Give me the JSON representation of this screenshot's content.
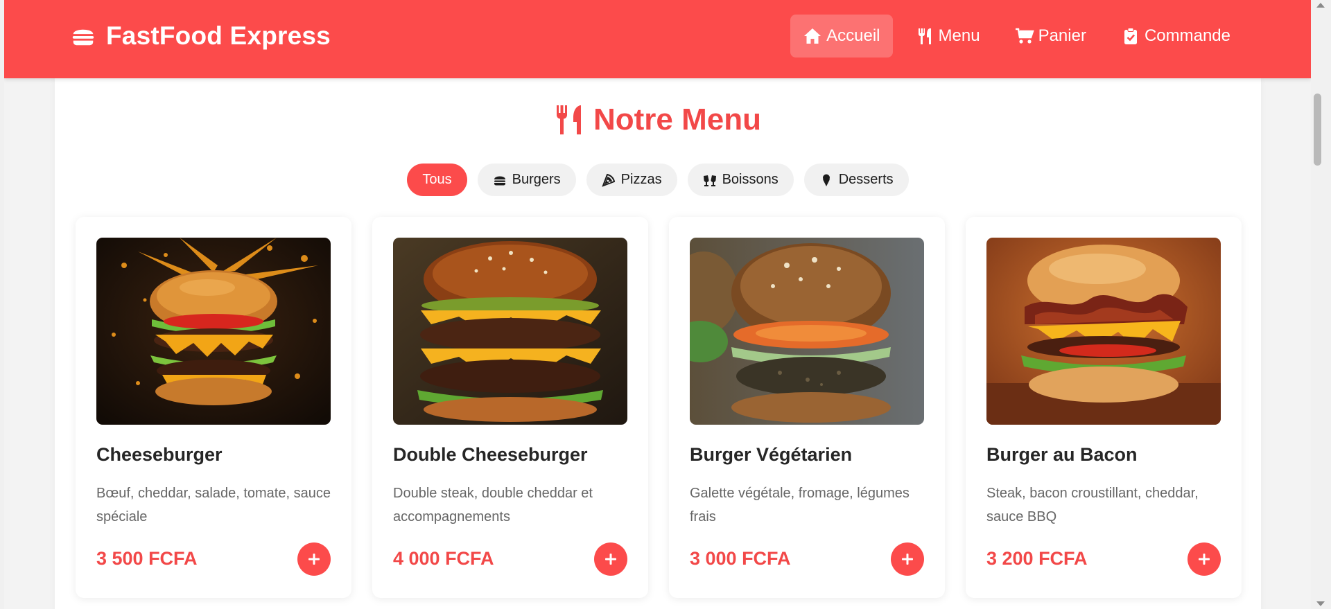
{
  "header": {
    "brand": "FastFood Express",
    "brand_icon": "burger-icon",
    "nav": [
      {
        "label": "Accueil",
        "icon": "home-icon",
        "active": true
      },
      {
        "label": "Menu",
        "icon": "utensils-icon",
        "active": false
      },
      {
        "label": "Panier",
        "icon": "cart-icon",
        "active": false
      },
      {
        "label": "Commande",
        "icon": "clipboard-check-icon",
        "active": false
      }
    ]
  },
  "main": {
    "title": "Notre Menu",
    "title_icon": "utensils-icon",
    "filters": [
      {
        "label": "Tous",
        "icon": "",
        "active": true
      },
      {
        "label": "Burgers",
        "icon": "burger-icon",
        "active": false
      },
      {
        "label": "Pizzas",
        "icon": "pizza-slice-icon",
        "active": false
      },
      {
        "label": "Boissons",
        "icon": "glasses-icon",
        "active": false
      },
      {
        "label": "Desserts",
        "icon": "ice-cream-icon",
        "active": false
      }
    ],
    "items": [
      {
        "name": "Cheeseburger",
        "description": "Bœuf, cheddar, salade, tomate, sauce spéciale",
        "price": "3 500 FCFA",
        "image": "cheeseburger-photo"
      },
      {
        "name": "Double Cheeseburger",
        "description": "Double steak, double cheddar et accompagnements",
        "price": "4 000 FCFA",
        "image": "double-cheeseburger-photo"
      },
      {
        "name": "Burger Végétarien",
        "description": "Galette végétale, fromage, légumes frais",
        "price": "3 000 FCFA",
        "image": "veggie-burger-photo"
      },
      {
        "name": "Burger au Bacon",
        "description": "Steak, bacon croustillant, cheddar, sauce BBQ",
        "price": "3 200 FCFA",
        "image": "bacon-burger-photo"
      }
    ]
  },
  "colors": {
    "primary": "#fc4b4b",
    "accent_text": "#f24848",
    "chip_bg": "#f1f1f1"
  }
}
